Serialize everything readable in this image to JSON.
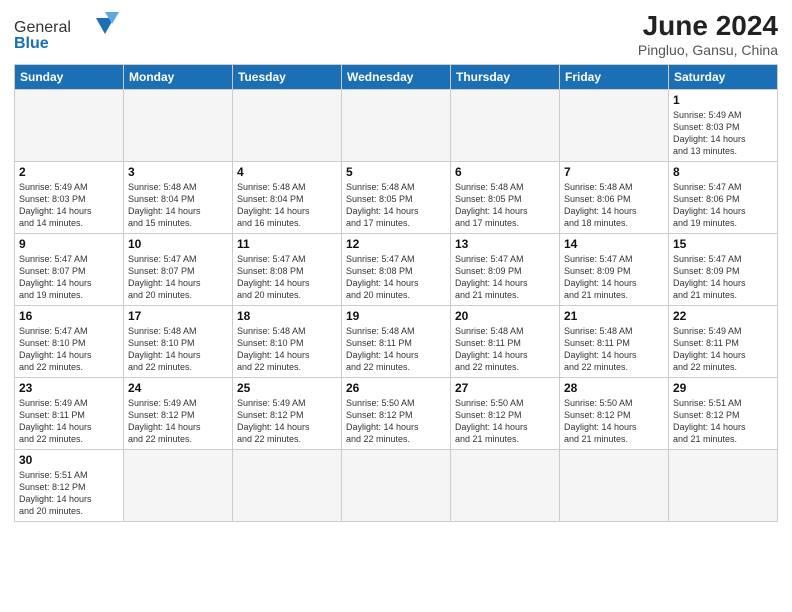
{
  "header": {
    "logo_general": "General",
    "logo_blue": "Blue",
    "title": "June 2024",
    "subtitle": "Pingluo, Gansu, China"
  },
  "weekdays": [
    "Sunday",
    "Monday",
    "Tuesday",
    "Wednesday",
    "Thursday",
    "Friday",
    "Saturday"
  ],
  "weeks": [
    [
      {
        "day": "",
        "info": "",
        "empty": true
      },
      {
        "day": "",
        "info": "",
        "empty": true
      },
      {
        "day": "",
        "info": "",
        "empty": true
      },
      {
        "day": "",
        "info": "",
        "empty": true
      },
      {
        "day": "",
        "info": "",
        "empty": true
      },
      {
        "day": "",
        "info": "",
        "empty": true
      },
      {
        "day": "1",
        "info": "Sunrise: 5:49 AM\nSunset: 8:03 PM\nDaylight: 14 hours\nand 13 minutes.",
        "empty": false
      }
    ],
    [
      {
        "day": "2",
        "info": "Sunrise: 5:49 AM\nSunset: 8:03 PM\nDaylight: 14 hours\nand 14 minutes.",
        "empty": false
      },
      {
        "day": "3",
        "info": "Sunrise: 5:48 AM\nSunset: 8:04 PM\nDaylight: 14 hours\nand 15 minutes.",
        "empty": false
      },
      {
        "day": "4",
        "info": "Sunrise: 5:48 AM\nSunset: 8:04 PM\nDaylight: 14 hours\nand 16 minutes.",
        "empty": false
      },
      {
        "day": "5",
        "info": "Sunrise: 5:48 AM\nSunset: 8:05 PM\nDaylight: 14 hours\nand 17 minutes.",
        "empty": false
      },
      {
        "day": "6",
        "info": "Sunrise: 5:48 AM\nSunset: 8:05 PM\nDaylight: 14 hours\nand 17 minutes.",
        "empty": false
      },
      {
        "day": "7",
        "info": "Sunrise: 5:48 AM\nSunset: 8:06 PM\nDaylight: 14 hours\nand 18 minutes.",
        "empty": false
      },
      {
        "day": "8",
        "info": "Sunrise: 5:47 AM\nSunset: 8:06 PM\nDaylight: 14 hours\nand 19 minutes.",
        "empty": false
      }
    ],
    [
      {
        "day": "9",
        "info": "Sunrise: 5:47 AM\nSunset: 8:07 PM\nDaylight: 14 hours\nand 19 minutes.",
        "empty": false
      },
      {
        "day": "10",
        "info": "Sunrise: 5:47 AM\nSunset: 8:07 PM\nDaylight: 14 hours\nand 20 minutes.",
        "empty": false
      },
      {
        "day": "11",
        "info": "Sunrise: 5:47 AM\nSunset: 8:08 PM\nDaylight: 14 hours\nand 20 minutes.",
        "empty": false
      },
      {
        "day": "12",
        "info": "Sunrise: 5:47 AM\nSunset: 8:08 PM\nDaylight: 14 hours\nand 20 minutes.",
        "empty": false
      },
      {
        "day": "13",
        "info": "Sunrise: 5:47 AM\nSunset: 8:09 PM\nDaylight: 14 hours\nand 21 minutes.",
        "empty": false
      },
      {
        "day": "14",
        "info": "Sunrise: 5:47 AM\nSunset: 8:09 PM\nDaylight: 14 hours\nand 21 minutes.",
        "empty": false
      },
      {
        "day": "15",
        "info": "Sunrise: 5:47 AM\nSunset: 8:09 PM\nDaylight: 14 hours\nand 21 minutes.",
        "empty": false
      }
    ],
    [
      {
        "day": "16",
        "info": "Sunrise: 5:47 AM\nSunset: 8:10 PM\nDaylight: 14 hours\nand 22 minutes.",
        "empty": false
      },
      {
        "day": "17",
        "info": "Sunrise: 5:48 AM\nSunset: 8:10 PM\nDaylight: 14 hours\nand 22 minutes.",
        "empty": false
      },
      {
        "day": "18",
        "info": "Sunrise: 5:48 AM\nSunset: 8:10 PM\nDaylight: 14 hours\nand 22 minutes.",
        "empty": false
      },
      {
        "day": "19",
        "info": "Sunrise: 5:48 AM\nSunset: 8:11 PM\nDaylight: 14 hours\nand 22 minutes.",
        "empty": false
      },
      {
        "day": "20",
        "info": "Sunrise: 5:48 AM\nSunset: 8:11 PM\nDaylight: 14 hours\nand 22 minutes.",
        "empty": false
      },
      {
        "day": "21",
        "info": "Sunrise: 5:48 AM\nSunset: 8:11 PM\nDaylight: 14 hours\nand 22 minutes.",
        "empty": false
      },
      {
        "day": "22",
        "info": "Sunrise: 5:49 AM\nSunset: 8:11 PM\nDaylight: 14 hours\nand 22 minutes.",
        "empty": false
      }
    ],
    [
      {
        "day": "23",
        "info": "Sunrise: 5:49 AM\nSunset: 8:11 PM\nDaylight: 14 hours\nand 22 minutes.",
        "empty": false
      },
      {
        "day": "24",
        "info": "Sunrise: 5:49 AM\nSunset: 8:12 PM\nDaylight: 14 hours\nand 22 minutes.",
        "empty": false
      },
      {
        "day": "25",
        "info": "Sunrise: 5:49 AM\nSunset: 8:12 PM\nDaylight: 14 hours\nand 22 minutes.",
        "empty": false
      },
      {
        "day": "26",
        "info": "Sunrise: 5:50 AM\nSunset: 8:12 PM\nDaylight: 14 hours\nand 22 minutes.",
        "empty": false
      },
      {
        "day": "27",
        "info": "Sunrise: 5:50 AM\nSunset: 8:12 PM\nDaylight: 14 hours\nand 21 minutes.",
        "empty": false
      },
      {
        "day": "28",
        "info": "Sunrise: 5:50 AM\nSunset: 8:12 PM\nDaylight: 14 hours\nand 21 minutes.",
        "empty": false
      },
      {
        "day": "29",
        "info": "Sunrise: 5:51 AM\nSunset: 8:12 PM\nDaylight: 14 hours\nand 21 minutes.",
        "empty": false
      }
    ],
    [
      {
        "day": "30",
        "info": "Sunrise: 5:51 AM\nSunset: 8:12 PM\nDaylight: 14 hours\nand 20 minutes.",
        "empty": false
      },
      {
        "day": "",
        "info": "",
        "empty": true
      },
      {
        "day": "",
        "info": "",
        "empty": true
      },
      {
        "day": "",
        "info": "",
        "empty": true
      },
      {
        "day": "",
        "info": "",
        "empty": true
      },
      {
        "day": "",
        "info": "",
        "empty": true
      },
      {
        "day": "",
        "info": "",
        "empty": true
      }
    ]
  ]
}
